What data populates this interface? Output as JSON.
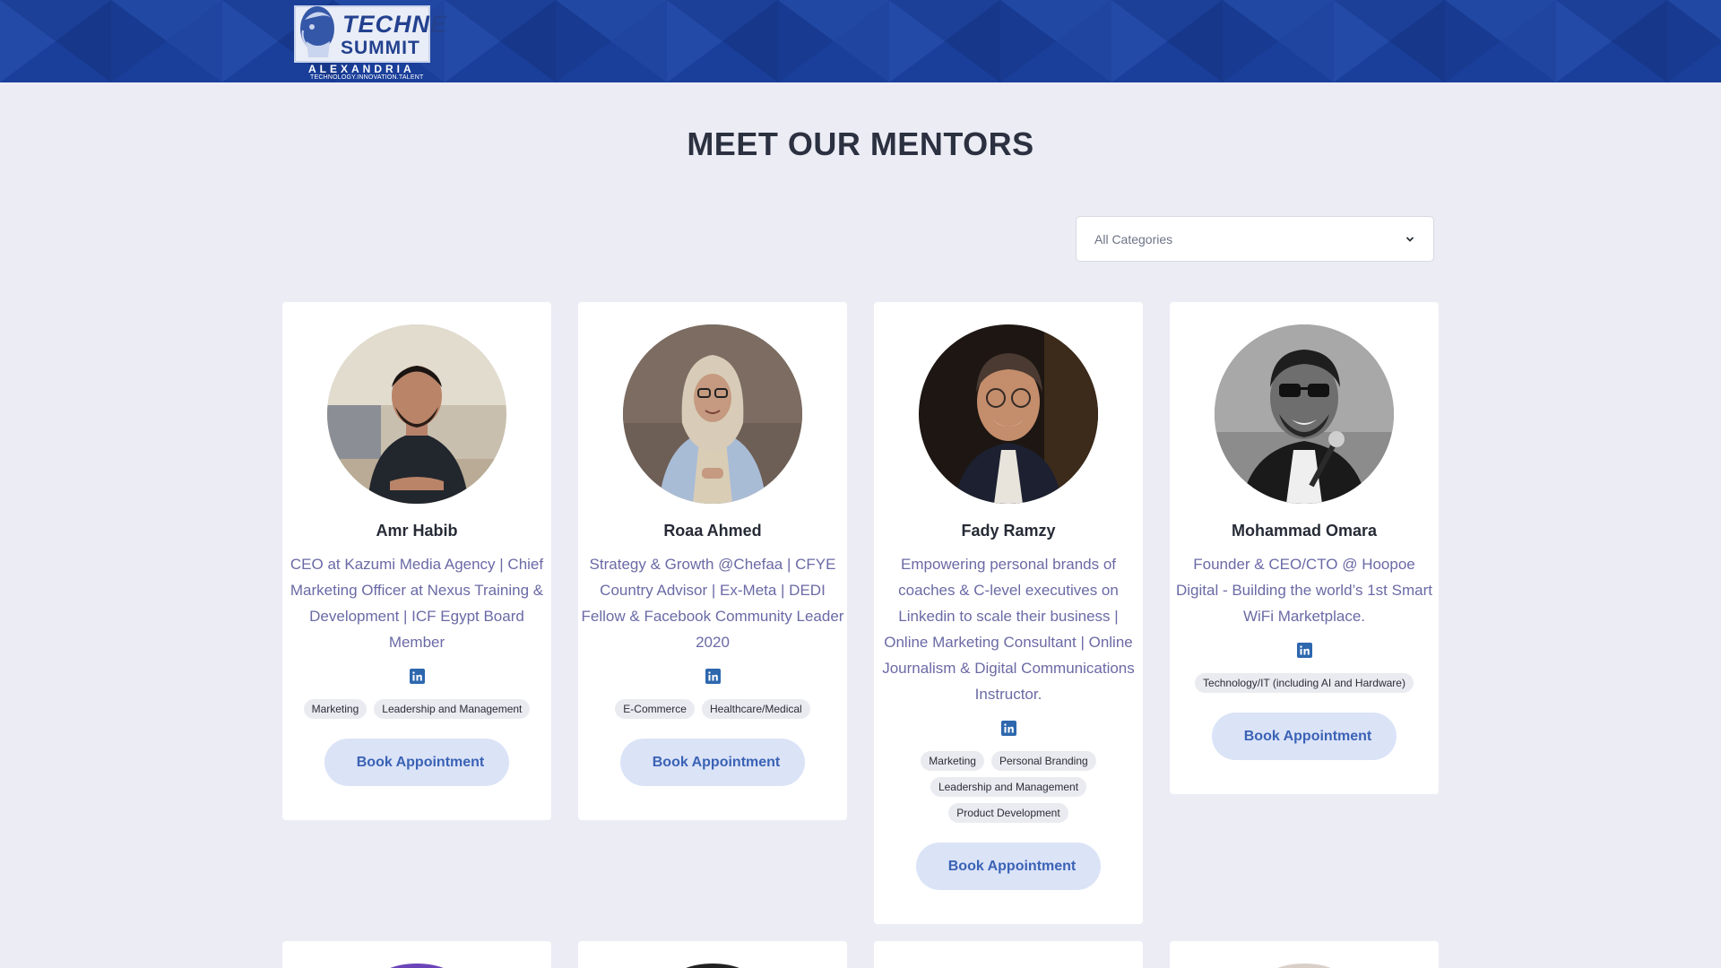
{
  "header": {
    "logo": {
      "line1": "TECHNE",
      "line2": "SUMMIT",
      "line3": "ALEXANDRIA",
      "tagline": "TECHNOLOGY.INNOVATION.TALENT"
    }
  },
  "main": {
    "title": "MEET OUR MENTORS",
    "filter": {
      "selected": "All Categories"
    }
  },
  "mentors": [
    {
      "name": "Amr Habib",
      "bio": "CEO at Kazumi Media Agency | Chief Marketing Officer at Nexus Training & Development | ICF Egypt Board Member",
      "tags": [
        "Marketing",
        "Leadership and Management"
      ],
      "button": "Book Appointment"
    },
    {
      "name": "Roaa Ahmed",
      "bio": "Strategy & Growth @Chefaa | CFYE Country Advisor | Ex-Meta | DEDI Fellow & Facebook Community Leader 2020",
      "tags": [
        "E-Commerce",
        "Healthcare/Medical"
      ],
      "button": "Book Appointment"
    },
    {
      "name": "Fady Ramzy",
      "bio": "Empowering personal brands of coaches & C-level executives on Linkedin to scale their business | Online Marketing Consultant | Online Journalism & Digital Communications Instructor.",
      "tags": [
        "Marketing",
        "Personal Branding",
        "Leadership and Management",
        "Product Development"
      ],
      "button": "Book Appointment"
    },
    {
      "name": "Mohammad Omara",
      "bio": "Founder & CEO/CTO @ Hoopoe Digital - Building the world’s 1st Smart WiFi Marketplace.",
      "tags": [
        "Technology/IT (including AI and Hardware)"
      ],
      "button": "Book Appointment"
    }
  ],
  "icons": {
    "social": "linkedin-icon",
    "dropdown": "chevron-down-icon"
  },
  "colors": {
    "banner": "#1a3f9a",
    "background": "#ececf5",
    "bio_text": "#6a6aa6",
    "button_bg": "#dbe3f7",
    "button_text": "#3a62b5",
    "linkedin": "#2d67ae"
  }
}
